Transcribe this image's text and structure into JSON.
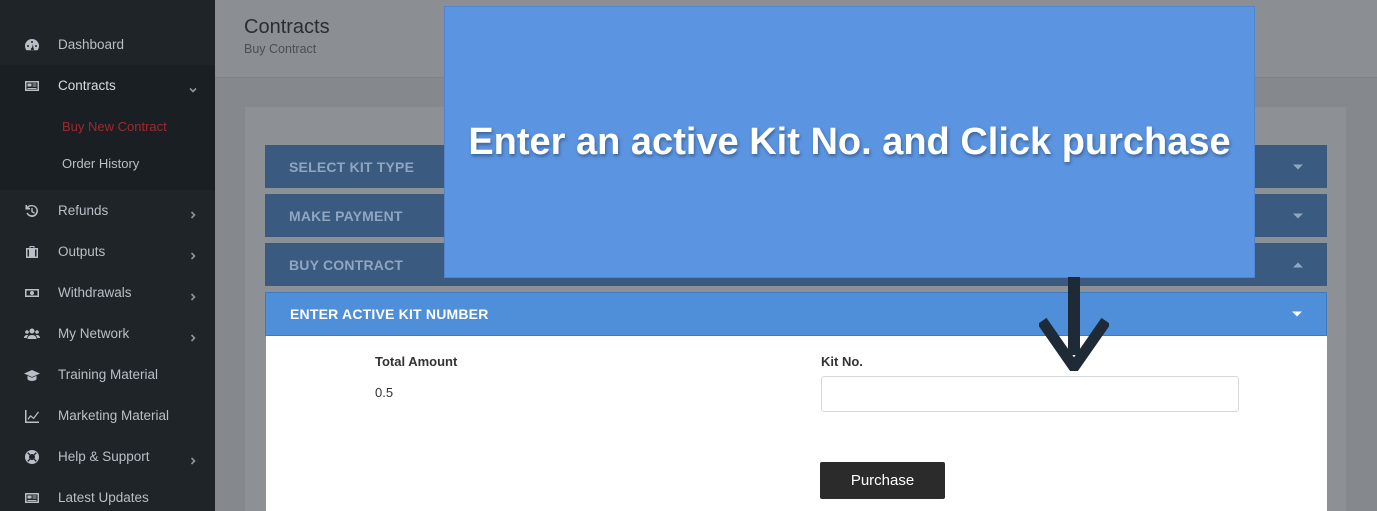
{
  "sidebar": {
    "items": [
      {
        "label": "Dashboard",
        "icon": "dashboard-icon"
      },
      {
        "label": "Contracts",
        "icon": "contracts-icon"
      },
      {
        "label": "Refunds",
        "icon": "refund-icon"
      },
      {
        "label": "Outputs",
        "icon": "briefcase-icon"
      },
      {
        "label": "Withdrawals",
        "icon": "money-icon"
      },
      {
        "label": "My Network",
        "icon": "users-icon"
      },
      {
        "label": "Training Material",
        "icon": "graduation-cap-icon"
      },
      {
        "label": "Marketing Material",
        "icon": "line-chart-icon"
      },
      {
        "label": "Help & Support",
        "icon": "lifebuoy-icon"
      },
      {
        "label": "Latest Updates",
        "icon": "newspaper-icon"
      }
    ],
    "submenu": [
      {
        "label": "Buy New Contract"
      },
      {
        "label": "Order History"
      }
    ]
  },
  "header": {
    "title": "Contracts",
    "subtitle": "Buy Contract"
  },
  "accordion": {
    "select_kit": "SELECT KIT TYPE",
    "make_payment": "MAKE PAYMENT",
    "buy_contract": "BUY CONTRACT",
    "enter_kit": "ENTER ACTIVE KIT NUMBER"
  },
  "form": {
    "total_amount_label": "Total Amount",
    "total_amount_value": "0.5",
    "kit_no_label": "Kit No.",
    "kit_no_value": "",
    "purchase_label": "Purchase"
  },
  "overlay": {
    "instruction": "Enter an active Kit No. and Click purchase"
  },
  "colors": {
    "active_accent": "#4f8ed9",
    "active_sub_item": "#a0282d",
    "callout_bg": "#5b94e0"
  }
}
